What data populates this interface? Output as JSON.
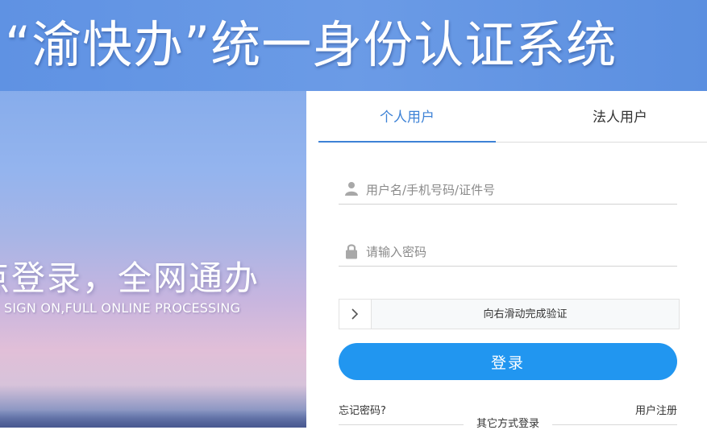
{
  "header": {
    "title": "“渝快办”统一身份认证系统"
  },
  "hero": {
    "slogan_cn": "点登录，全网通办",
    "slogan_en": "SIGN ON,FULL ONLINE PROCESSING"
  },
  "tabs": [
    {
      "label": "个人用户",
      "active": true
    },
    {
      "label": "法人用户",
      "active": false
    }
  ],
  "form": {
    "username_placeholder": "用户名/手机号码/证件号",
    "username_icon": "user-icon",
    "password_placeholder": "请输入密码",
    "password_icon": "lock-icon",
    "slider_text": "向右滑动完成验证",
    "slider_icon": "chevron-right-icon",
    "login_label": "登录"
  },
  "links": {
    "forgot_password": "忘记密码?",
    "register": "用户注册",
    "other_login": "其它方式登录"
  },
  "colors": {
    "accent": "#3d82d6",
    "button": "#2196f0",
    "header": "#5f92e3"
  }
}
